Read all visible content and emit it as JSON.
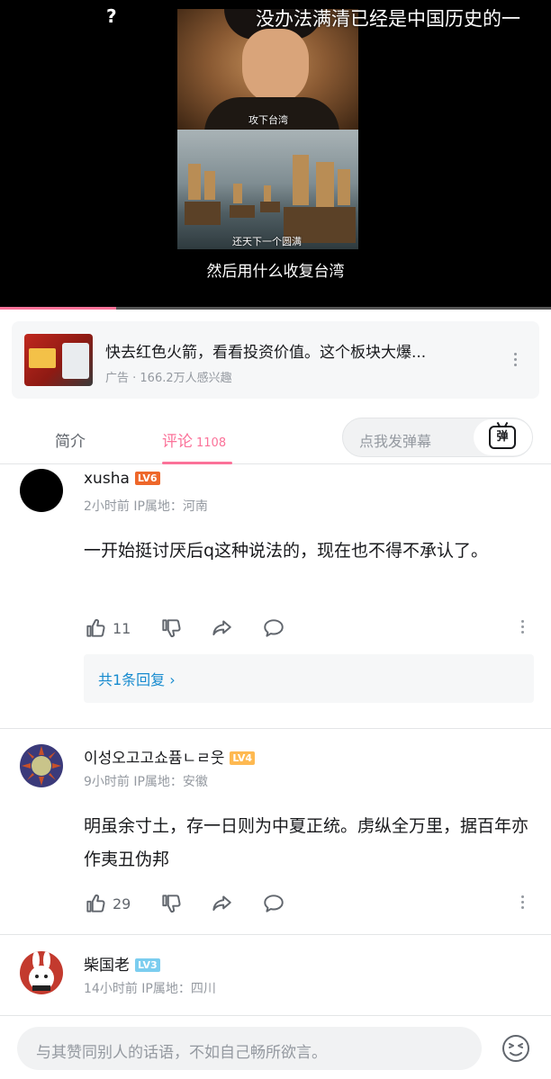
{
  "video": {
    "title_overlay": "没办法满清已经是中国历史的一",
    "question_mark": "?",
    "caption_top": "攻下台湾",
    "caption_bottom": "还天下一个圆满",
    "subtitle": "然后用什么收复台湾",
    "progress_fraction": 0.21
  },
  "ad": {
    "title": "快去红色火箭，看看投资价值。这个板块大爆...",
    "meta": "广告 · 166.2万人感兴趣"
  },
  "tabs": {
    "intro": "简介",
    "comments": "评论",
    "comments_count": "1108",
    "danmaku_placeholder": "点我发弹幕",
    "danmaku_button": "弹"
  },
  "comments": [
    {
      "username": "xusha",
      "level": "LV6",
      "level_color": "#ee672a",
      "meta": "2小时前 IP属地：河南",
      "text": "一开始挺讨厌后q这种说法的，现在也不得不承认了。",
      "likes": "11",
      "reply_summary": "共1条回复 ›"
    },
    {
      "username": "이성오고고쇼퓸ㄴㄹ웃",
      "level": "LV4",
      "level_color": "#feb951",
      "meta": "9小时前 IP属地：安徽",
      "text": "明虽余寸土，存一日则为中夏正统。虏纵全万里，据百年亦作夷丑伪邦",
      "likes": "29"
    },
    {
      "username": "柴国老",
      "level": "LV3",
      "level_color": "#7bcdef",
      "meta": "14小时前 IP属地：四川"
    }
  ],
  "bottom": {
    "input_placeholder": "与其赞同别人的话语，不如自己畅所欲言。"
  },
  "colors": {
    "accent": "#fb7299",
    "link": "#178bcf",
    "text_secondary": "#9499a0"
  },
  "icons": [
    "like-icon",
    "dislike-icon",
    "share-icon",
    "reply-icon",
    "more-icon",
    "emoji-icon",
    "danmaku-tv-icon"
  ]
}
